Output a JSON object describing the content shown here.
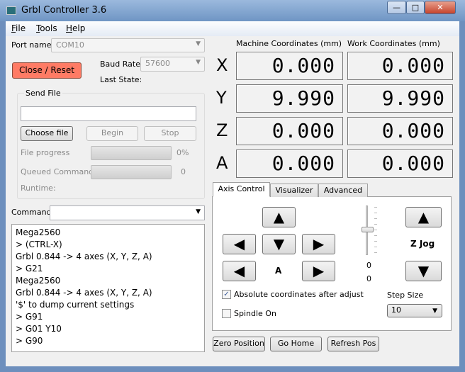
{
  "window": {
    "title": "Grbl Controller 3.6",
    "minimize": "—",
    "maximize": "□",
    "close": "✕"
  },
  "menu": [
    "File",
    "Tools",
    "Help"
  ],
  "connection": {
    "port_label": "Port name",
    "port_value": "COM10",
    "baud_label": "Baud Rate",
    "baud_value": "57600",
    "close_reset": "Close / Reset",
    "last_state": "Last State:"
  },
  "send_file": {
    "group_label": "Send File",
    "path": "",
    "choose": "Choose file",
    "begin": "Begin",
    "stop": "Stop",
    "file_progress_label": "File progress",
    "file_progress_value": "0%",
    "file_progress": 0,
    "queued_label": "Queued Commands",
    "queued_value": "0",
    "queued_progress": 0,
    "runtime": "Runtime:"
  },
  "command": {
    "label": "Command",
    "value": ""
  },
  "log": [
    "Mega2560",
    "> (CTRL-X)",
    "Grbl 0.844 -> 4 axes (X, Y, Z, A)",
    "> G21",
    "Mega2560",
    "Grbl 0.844 -> 4 axes (X, Y, Z, A)",
    "'$' to dump current settings",
    "> G91",
    "> G01 Y10",
    "> G90"
  ],
  "coords": {
    "machine_heading": "Machine Coordinates  (mm)",
    "work_heading": "Work Coordinates  (mm)",
    "axes": [
      {
        "name": "X",
        "machine": "0.000",
        "work": "0.000"
      },
      {
        "name": "Y",
        "machine": "9.990",
        "work": "9.990"
      },
      {
        "name": "Z",
        "machine": "0.000",
        "work": "0.000"
      },
      {
        "name": "A",
        "machine": "0.000",
        "work": "0.000"
      }
    ]
  },
  "tabs": [
    "Axis Control",
    "Visualizer",
    "Advanced"
  ],
  "axis_control": {
    "a_label": "A",
    "z_jog": "Z Jog",
    "slider_value_1": "0",
    "slider_value_2": "0",
    "absolute_label": "Absolute coordinates after adjust",
    "absolute_checked": true,
    "spindle_label": "Spindle On",
    "spindle_checked": false,
    "step_size_label": "Step Size",
    "step_size": "10"
  },
  "bottom": {
    "zero": "Zero Position",
    "home": "Go Home",
    "refresh": "Refresh Pos"
  },
  "colors": {
    "close_reset": "#ff7b65"
  }
}
